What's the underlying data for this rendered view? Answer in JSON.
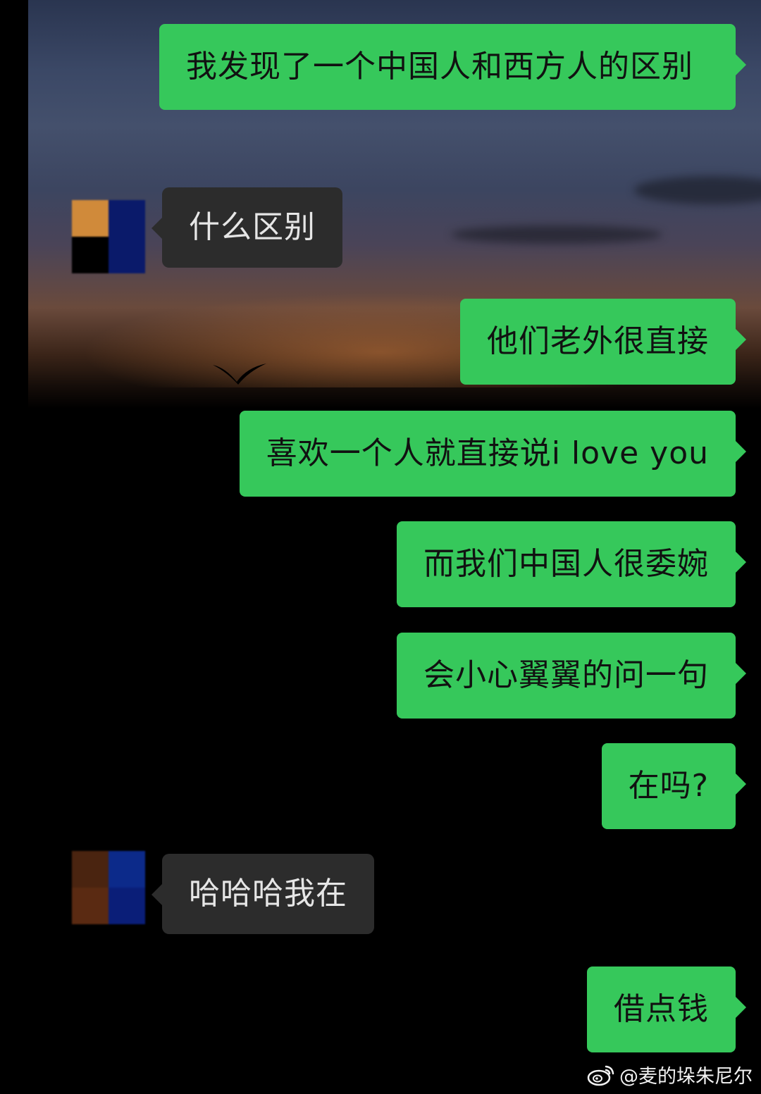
{
  "colors": {
    "my_bubble": "#36c85b",
    "other_bubble": "#2c2c2c",
    "background": "#000000"
  },
  "messages": [
    {
      "side": "me",
      "text": "我发现了一个中国人和西方人的区别"
    },
    {
      "side": "other",
      "text": "什么区别"
    },
    {
      "side": "me",
      "text": "他们老外很直接"
    },
    {
      "side": "me",
      "text": "喜欢一个人就直接说i love you"
    },
    {
      "side": "me",
      "text": "而我们中国人很委婉"
    },
    {
      "side": "me",
      "text": "会小心翼翼的问一句"
    },
    {
      "side": "me",
      "text": "在吗?"
    },
    {
      "side": "other",
      "text": "哈哈哈我在"
    },
    {
      "side": "me",
      "text": "借点钱"
    }
  ],
  "avatars": [
    {
      "pixels": [
        "#3a1e14",
        "#d08a3a",
        "#0a1a6a",
        "#000000"
      ]
    },
    {
      "pixels": [
        "#4a2410",
        "#0c2a8a",
        "#5a2a12",
        "#0a1e78"
      ]
    }
  ],
  "watermark": {
    "icon": "weibo-icon",
    "text": "@麦的垛朱尼尔"
  }
}
